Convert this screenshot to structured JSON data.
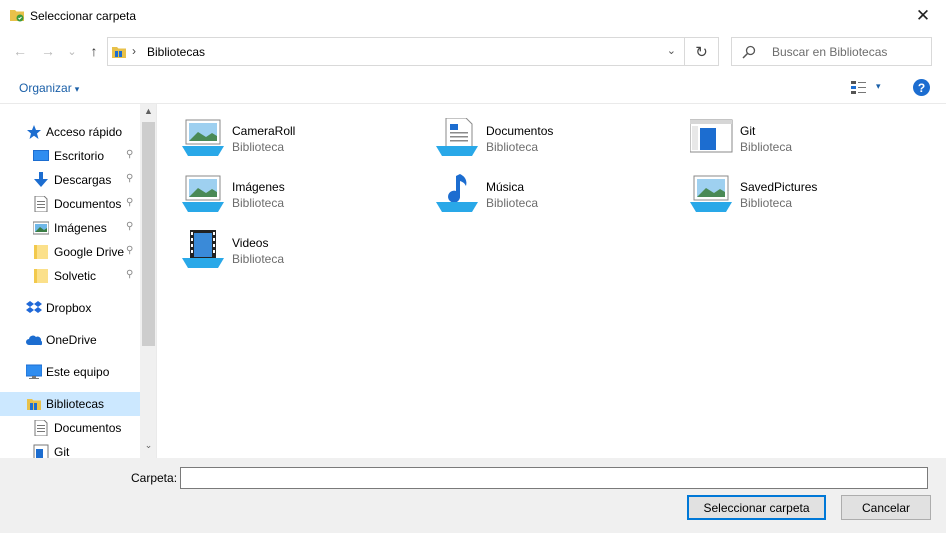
{
  "window": {
    "title": "Seleccionar carpeta",
    "close_glyph": "✕"
  },
  "navigation": {
    "back_glyph": "←",
    "forward_glyph": "→",
    "recent_glyph": "⌄",
    "up_glyph": "↑",
    "address_separator": "›",
    "address_path": "Bibliotecas",
    "address_dropdown_glyph": "⌄",
    "refresh_glyph": "↻",
    "search_placeholder": "Buscar en Bibliotecas"
  },
  "toolbar": {
    "organize_label": "Organizar",
    "organize_caret": "▾",
    "view_caret": "▾",
    "help_label": "?"
  },
  "sidebar": {
    "pin_glyph": "📌",
    "items": [
      {
        "label": "Acceso rápido",
        "icon": "star-icon",
        "pinned": false
      },
      {
        "label": "Escritorio",
        "icon": "desktop-icon",
        "pinned": true
      },
      {
        "label": "Descargas",
        "icon": "download-icon",
        "pinned": true
      },
      {
        "label": "Documentos",
        "icon": "document-icon",
        "pinned": true
      },
      {
        "label": "Imágenes",
        "icon": "pictures-icon",
        "pinned": true
      },
      {
        "label": "Google Drive",
        "icon": "folder-icon",
        "pinned": true
      },
      {
        "label": "Solvetic",
        "icon": "folder-icon",
        "pinned": true
      },
      {
        "label": "Dropbox",
        "icon": "dropbox-icon",
        "pinned": false
      },
      {
        "label": "OneDrive",
        "icon": "cloud-icon",
        "pinned": false
      },
      {
        "label": "Este equipo",
        "icon": "computer-icon",
        "pinned": false
      },
      {
        "label": "Bibliotecas",
        "icon": "libraries-icon",
        "pinned": false,
        "selected": true
      },
      {
        "label": "Documentos",
        "icon": "document-icon",
        "pinned": false
      },
      {
        "label": "Git",
        "icon": "git-library-icon",
        "pinned": false
      }
    ],
    "scroll_up_glyph": "▲",
    "scroll_down_glyph": "⌄"
  },
  "libraries": [
    {
      "name": "CameraRoll",
      "type": "Biblioteca",
      "icon": "picture-library-icon"
    },
    {
      "name": "Documentos",
      "type": "Biblioteca",
      "icon": "document-library-icon"
    },
    {
      "name": "Git",
      "type": "Biblioteca",
      "icon": "generic-library-icon"
    },
    {
      "name": "Imágenes",
      "type": "Biblioteca",
      "icon": "picture-library-icon"
    },
    {
      "name": "Música",
      "type": "Biblioteca",
      "icon": "music-library-icon"
    },
    {
      "name": "SavedPictures",
      "type": "Biblioteca",
      "icon": "picture-library-icon"
    },
    {
      "name": "Videos",
      "type": "Biblioteca",
      "icon": "video-library-icon"
    }
  ],
  "footer": {
    "folder_label": "Carpeta:",
    "folder_value": "",
    "select_button": "Seleccionar carpeta",
    "cancel_button": "Cancelar"
  },
  "colors": {
    "accent": "#0078d7",
    "link": "#1a5fa8",
    "selection": "#cce8ff",
    "footer_bg": "#f0f0f0"
  }
}
